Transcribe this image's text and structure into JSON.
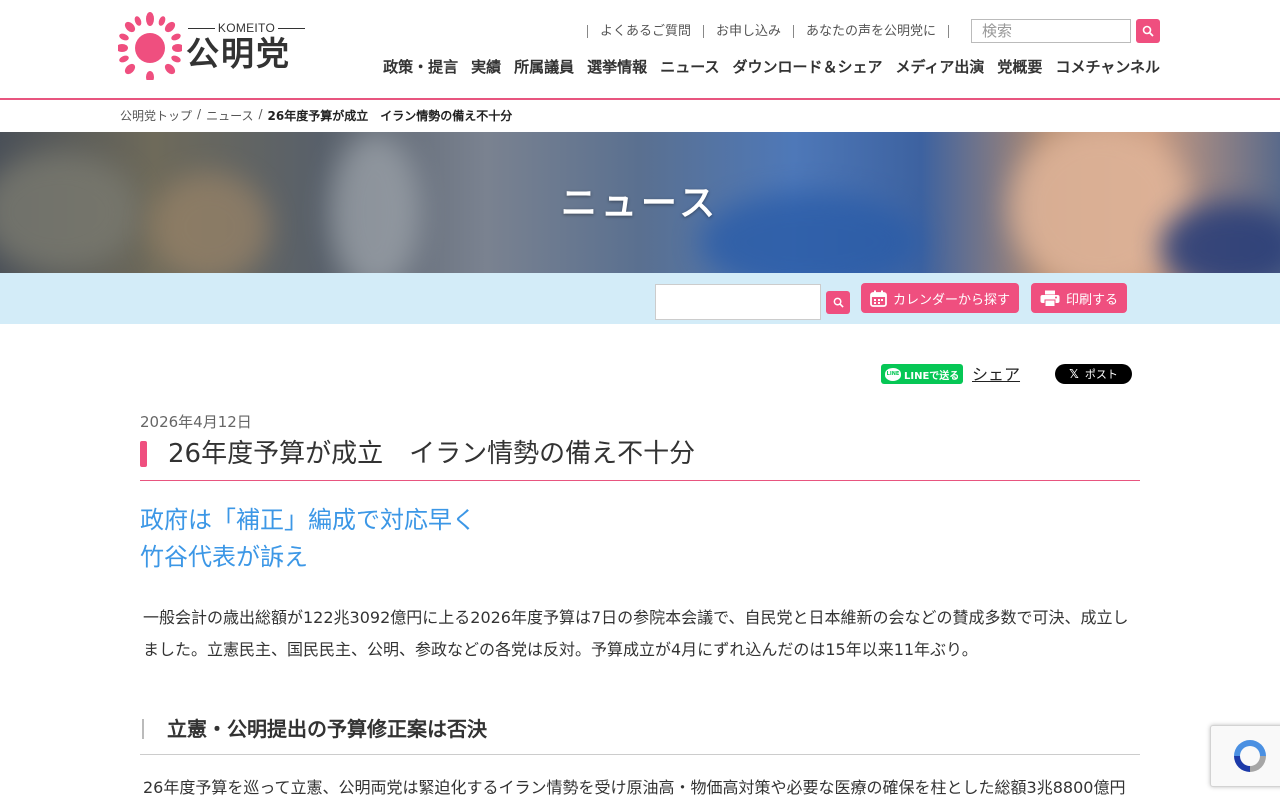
{
  "brand": {
    "english": "KOMEITO",
    "japanese": "公明党",
    "color": "#ef4f7f"
  },
  "utility_links": [
    "よくあるご質問",
    "お申し込み",
    "あなたの声を公明党に"
  ],
  "search": {
    "placeholder": "検索",
    "icon": "search-icon"
  },
  "global_nav": [
    "政策・提言",
    "実績",
    "所属議員",
    "選挙情報",
    "ニュース",
    "ダウンロード＆シェア",
    "メディア出演",
    "党概要",
    "コメチャンネル"
  ],
  "breadcrumb": [
    "公明党トップ",
    "ニュース",
    "26年度予算が成立　イラン情勢の備え不十分"
  ],
  "hero": {
    "title": "ニュース"
  },
  "toolbar": {
    "search_icon": "search-icon",
    "calendar_label": "カレンダーから探す",
    "calendar_icon": "calendar-icon",
    "print_label": "印刷する",
    "print_icon": "printer-icon",
    "accent": "#ef4f7f",
    "background": "#d3ecf8"
  },
  "share": {
    "line_label": "LINEで送る",
    "line_bubble": "LINE",
    "share_label": "シェア",
    "x_mark": "𝕏",
    "x_label": "ポスト"
  },
  "article": {
    "date": "2026年4月12日",
    "title": "26年度予算が成立　イラン情勢の備え不十分",
    "subtitle_line1": "政府は「補正」編成で対応早く",
    "subtitle_line2": "竹谷代表が訴え",
    "paragraph1": "一般会計の歳出総額が122兆3092億円に上る2026年度予算は7日の参院本会議で、自民党と日本維新の会などの賛成多数で可決、成立しました。立憲民主、国民民主、公明、参政などの各党は反対。予算成立が4月にずれ込んだのは15年以来11年ぶり。",
    "heading2": "立憲・公明提出の予算修正案は否決",
    "paragraph2": "26年度予算を巡って立憲、公明両党は緊迫化するイラン情勢を受け原油高・物価高対策や必要な医療の確保を柱とした総額3兆8800億円"
  }
}
